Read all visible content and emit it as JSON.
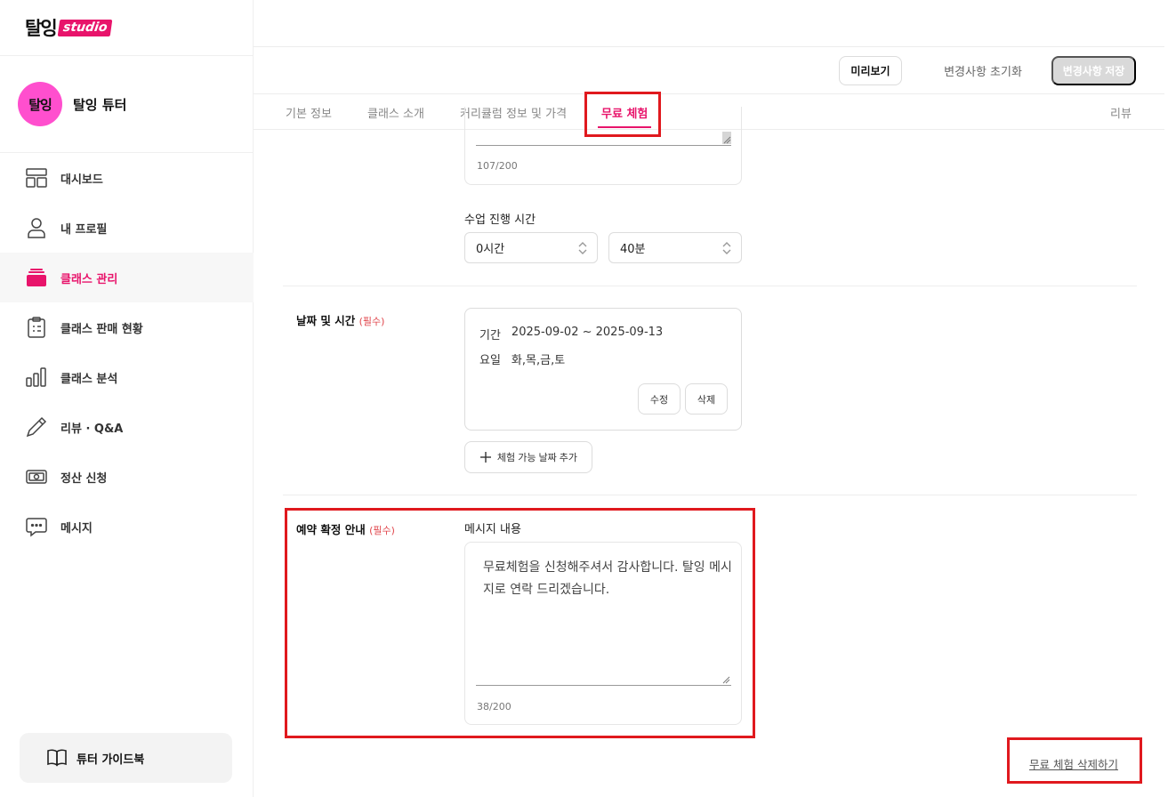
{
  "brand": {
    "logo_main": "탈잉",
    "logo_tag": "studio",
    "accent": "#e8146b"
  },
  "profile": {
    "avatar_text": "탈잉",
    "name": "탈잉 튜터"
  },
  "nav": {
    "items": [
      {
        "label": "대시보드",
        "icon": "dashboard-icon"
      },
      {
        "label": "내 프로필",
        "icon": "user-icon"
      },
      {
        "label": "클래스 관리",
        "icon": "class-stack-icon",
        "active": true
      },
      {
        "label": "클래스 판매 현황",
        "icon": "clipboard-icon"
      },
      {
        "label": "클래스 분석",
        "icon": "bar-chart-icon"
      },
      {
        "label": "리뷰 · Q&A",
        "icon": "pencil-icon"
      },
      {
        "label": "정산 신청",
        "icon": "money-icon"
      },
      {
        "label": "메시지",
        "icon": "chat-icon"
      }
    ],
    "guide_label": "튜터 가이드북"
  },
  "toolbar": {
    "preview_label": "미리보기",
    "reset_label": "변경사항 초기화",
    "save_label": "변경사항 저장"
  },
  "tabs": [
    {
      "label": "기본 정보"
    },
    {
      "label": "클래스 소개"
    },
    {
      "label": "커리큘럼 정보 및 가격"
    },
    {
      "label": "무료 체험",
      "active": true
    },
    {
      "label": "리뷰"
    }
  ],
  "intro_card": {
    "counter": "107/200"
  },
  "duration": {
    "label": "수업 진행 시간",
    "hours_value": "0시간",
    "minutes_value": "40분"
  },
  "schedule": {
    "label": "날짜 및 시간",
    "required": "(필수)",
    "period_key": "기간",
    "period_value": "2025-09-02 ~ 2025-09-13",
    "days_key": "요일",
    "days_value": "화,목,금,토",
    "edit_label": "수정",
    "delete_label": "삭제",
    "add_label": "체험 가능 날짜 추가"
  },
  "confirmation": {
    "label": "예약 확정 안내",
    "required": "(필수)",
    "message_label": "메시지 내용",
    "message_text": "무료체험을 신청해주셔서 감사합니다. 탈잉 메시지로 연락 드리겠습니다.",
    "counter": "38/200"
  },
  "delete_trial_label": "무료 체험 삭제하기"
}
